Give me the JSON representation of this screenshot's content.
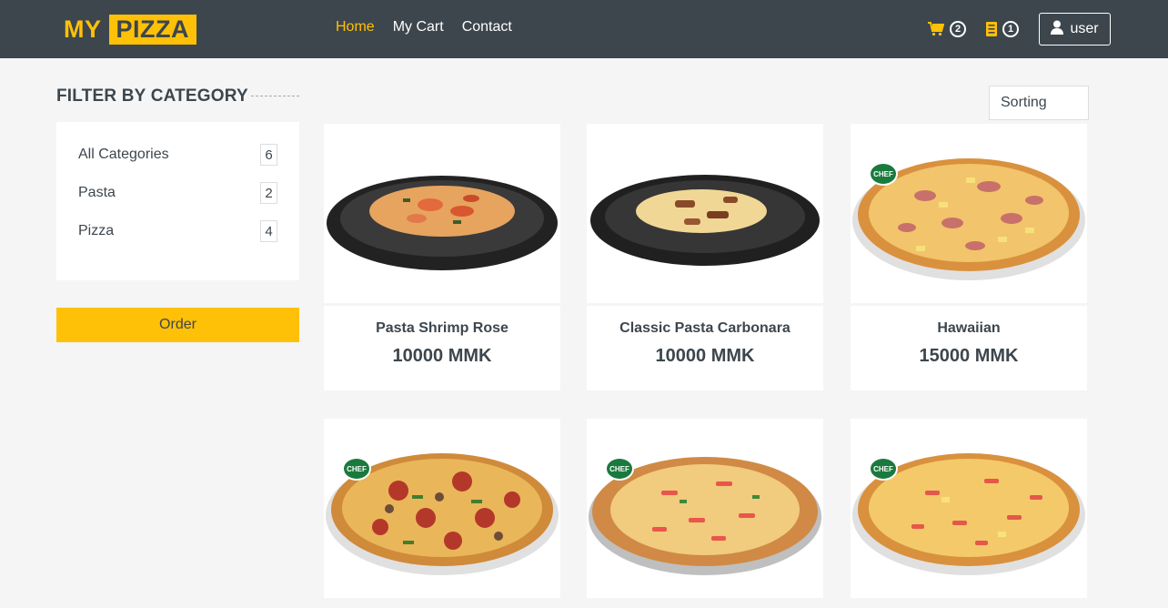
{
  "header": {
    "logo_part1": "MY",
    "logo_part2": "PIZZA",
    "nav": [
      {
        "label": "Home",
        "active": true
      },
      {
        "label": "My Cart",
        "active": false
      },
      {
        "label": "Contact",
        "active": false
      }
    ],
    "cart_count": "2",
    "orders_count": "1",
    "user_label": "user"
  },
  "sidebar": {
    "title": "FILTER BY CATEGORY",
    "categories": [
      {
        "label": "All Categories",
        "count": "6"
      },
      {
        "label": "Pasta",
        "count": "2"
      },
      {
        "label": "Pizza",
        "count": "4"
      }
    ],
    "order_label": "Order"
  },
  "sorting": {
    "label": "Sorting"
  },
  "products": [
    {
      "name": "Pasta Shrimp Rose",
      "price": "10000 MMK",
      "kind": "pasta"
    },
    {
      "name": "Classic Pasta Carbonara",
      "price": "10000 MMK",
      "kind": "pasta"
    },
    {
      "name": "Hawaiian",
      "price": "15000 MMK",
      "kind": "pizza"
    },
    {
      "name": "",
      "price": "",
      "kind": "pizza"
    },
    {
      "name": "",
      "price": "",
      "kind": "pizza"
    },
    {
      "name": "",
      "price": "",
      "kind": "pizza"
    }
  ],
  "colors": {
    "accent": "#ffc107",
    "dark": "#3d464d",
    "background": "#f5f5f5"
  }
}
